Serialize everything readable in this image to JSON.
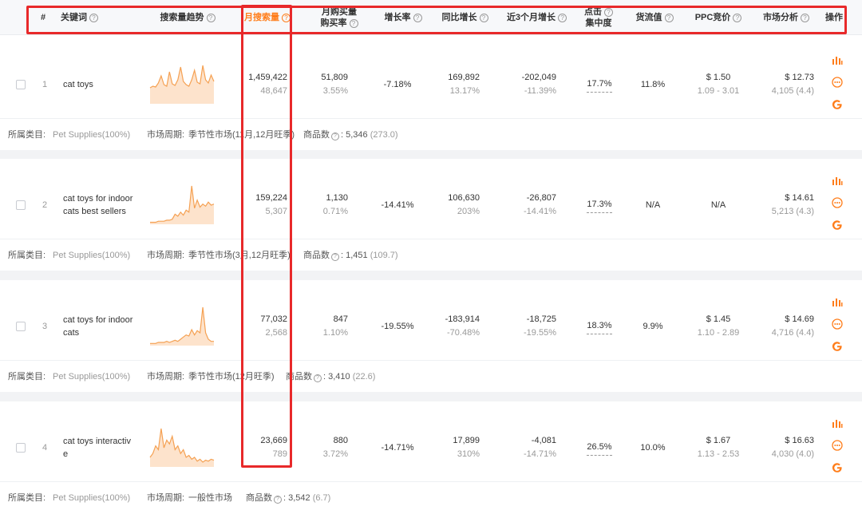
{
  "header": {
    "index": "#",
    "keyword": "关键词",
    "trend": "搜索量趋势",
    "monthly_search": "月搜索量",
    "monthly_buy_1": "月购买量",
    "monthly_buy_2": "购买率",
    "growth": "增长率",
    "yoy": "同比增长",
    "three_month_1": "近3个月增长",
    "click_1": "点击",
    "click_2": "集中度",
    "supply": "货流值",
    "ppc": "PPC竞价",
    "market": "市场分析",
    "ops": "操作"
  },
  "meta_labels": {
    "category": "所属类目:",
    "cycle": "市场周期:",
    "products": "商品数"
  },
  "rows": [
    {
      "index": "1",
      "keyword": "cat toys",
      "search": "1,459,422",
      "search_sub": "48,647",
      "buy": "51,809",
      "buy_rate": "3.55%",
      "growth": "-7.18%",
      "yoy": "169,892",
      "yoy_pct": "13.17%",
      "m3": "-202,049",
      "m3_pct": "-11.39%",
      "click": "17.7%",
      "supply": "11.8%",
      "ppc": "$ 1.50",
      "ppc_range": "1.09 - 3.01",
      "market": "$ 12.73",
      "market_sub": "4,105 (4.4)",
      "category": "Pet Supplies(100%)",
      "cycle": "季节性市场(11月,12月旺季)",
      "products": "5,346",
      "products_ratio": "(273.0)",
      "trend": [
        20,
        22,
        21,
        26,
        35,
        24,
        22,
        40,
        25,
        23,
        30,
        46,
        28,
        24,
        22,
        30,
        42,
        27,
        25,
        48,
        30,
        26,
        36,
        28
      ]
    },
    {
      "index": "2",
      "keyword": "cat toys for indoor cats best sellers",
      "search": "159,224",
      "search_sub": "5,307",
      "buy": "1,130",
      "buy_rate": "0.71%",
      "growth": "-14.41%",
      "yoy": "106,630",
      "yoy_pct": "203%",
      "m3": "-26,807",
      "m3_pct": "-14.41%",
      "click": "17.3%",
      "supply": "N/A",
      "ppc": "N/A",
      "ppc_range": "",
      "market": "$ 14.61",
      "market_sub": "5,213 (4.3)",
      "category": "Pet Supplies(100%)",
      "cycle": "季节性市场(3月,12月旺季)",
      "products": "1,451",
      "products_ratio": "(109.7)",
      "trend": [
        2,
        2,
        2,
        3,
        3,
        3,
        4,
        4,
        5,
        10,
        8,
        12,
        9,
        14,
        12,
        38,
        16,
        24,
        17,
        20,
        18,
        22,
        19,
        20
      ]
    },
    {
      "index": "3",
      "keyword": "cat toys for indoor cats",
      "search": "77,032",
      "search_sub": "2,568",
      "buy": "847",
      "buy_rate": "1.10%",
      "growth": "-19.55%",
      "yoy": "-183,914",
      "yoy_pct": "-70.48%",
      "m3": "-18,725",
      "m3_pct": "-19.55%",
      "click": "18.3%",
      "supply": "9.9%",
      "ppc": "$ 1.45",
      "ppc_range": "1.10 - 2.89",
      "market": "$ 14.69",
      "market_sub": "4,716 (4.4)",
      "category": "Pet Supplies(100%)",
      "cycle": "季节性市场(12月旺季)",
      "products": "3,410",
      "products_ratio": "(22.6)",
      "trend": [
        2,
        2,
        2,
        3,
        3,
        3,
        4,
        3,
        4,
        5,
        4,
        6,
        8,
        10,
        9,
        15,
        10,
        14,
        12,
        36,
        12,
        6,
        4,
        4
      ]
    },
    {
      "index": "4",
      "keyword": "cat toys interactive",
      "search": "23,669",
      "search_sub": "789",
      "buy": "880",
      "buy_rate": "3.72%",
      "growth": "-14.71%",
      "yoy": "17,899",
      "yoy_pct": "310%",
      "m3": "-4,081",
      "m3_pct": "-14.71%",
      "click": "26.5%",
      "supply": "10.0%",
      "ppc": "$ 1.67",
      "ppc_range": "1.13 - 2.53",
      "market": "$ 16.63",
      "market_sub": "4,030 (4.0)",
      "category": "Pet Supplies(100%)",
      "cycle": "一般性市场",
      "products": "3,542",
      "products_ratio": "(6.7)",
      "trend": [
        10,
        14,
        22,
        18,
        40,
        20,
        28,
        24,
        32,
        18,
        22,
        14,
        18,
        10,
        12,
        8,
        10,
        6,
        8,
        5,
        7,
        6,
        8,
        7
      ]
    }
  ]
}
